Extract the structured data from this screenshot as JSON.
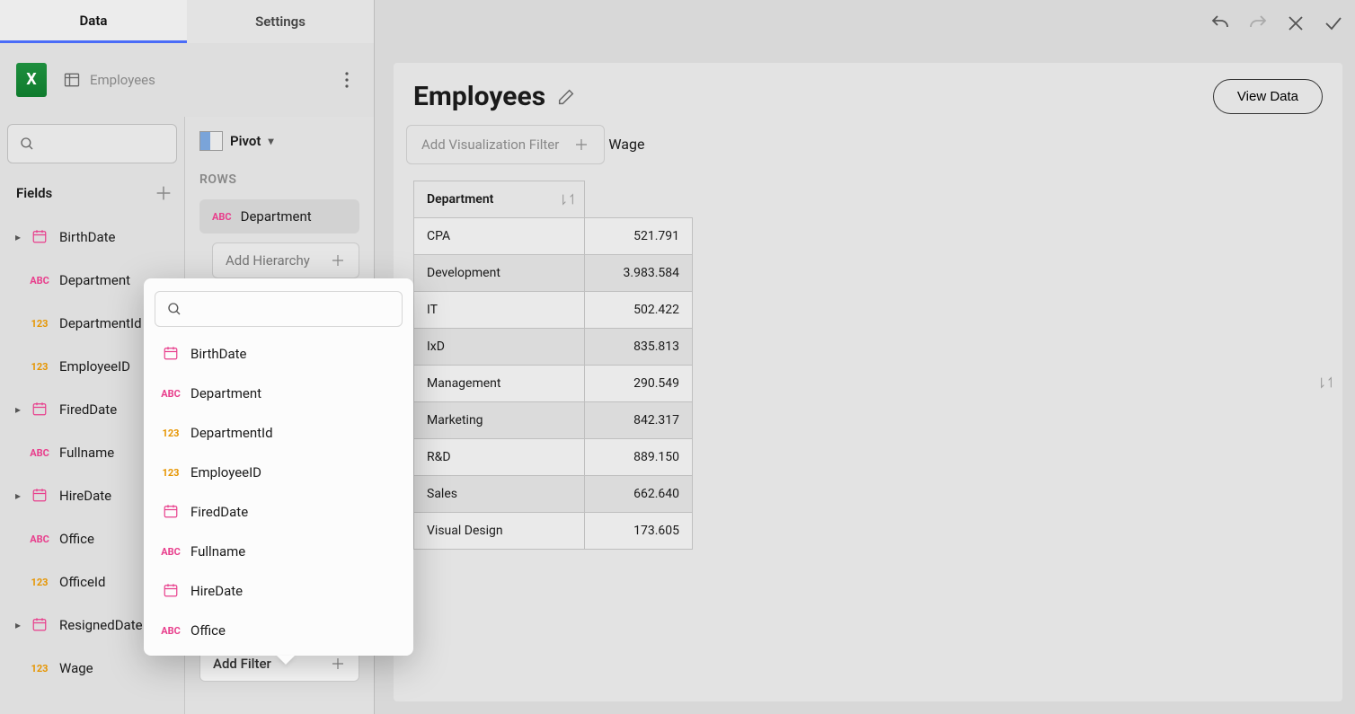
{
  "tabs": {
    "data": "Data",
    "settings": "Settings"
  },
  "datasource": {
    "name": "Employees"
  },
  "fields": {
    "header": "Fields",
    "items": [
      {
        "label": "BirthDate",
        "type": "date",
        "expandable": true
      },
      {
        "label": "Department",
        "type": "abc",
        "expandable": false
      },
      {
        "label": "DepartmentId",
        "type": "num",
        "expandable": false
      },
      {
        "label": "EmployeeID",
        "type": "num",
        "expandable": false
      },
      {
        "label": "FiredDate",
        "type": "date",
        "expandable": true
      },
      {
        "label": "Fullname",
        "type": "abc",
        "expandable": false
      },
      {
        "label": "HireDate",
        "type": "date",
        "expandable": true
      },
      {
        "label": "Office",
        "type": "abc",
        "expandable": false
      },
      {
        "label": "OfficeId",
        "type": "num",
        "expandable": false
      },
      {
        "label": "ResignedDate",
        "type": "date",
        "expandable": true
      },
      {
        "label": "Wage",
        "type": "num",
        "expandable": false
      }
    ]
  },
  "config": {
    "viz_type": "Pivot",
    "rows_label": "ROWS",
    "row_field": "Department",
    "add_hierarchy": "Add Hierarchy",
    "add_filter": "Add Filter"
  },
  "picker": {
    "items": [
      {
        "label": "BirthDate",
        "type": "date"
      },
      {
        "label": "Department",
        "type": "abc"
      },
      {
        "label": "DepartmentId",
        "type": "num"
      },
      {
        "label": "EmployeeID",
        "type": "num"
      },
      {
        "label": "FiredDate",
        "type": "date"
      },
      {
        "label": "Fullname",
        "type": "abc"
      },
      {
        "label": "HireDate",
        "type": "date"
      },
      {
        "label": "Office",
        "type": "abc"
      }
    ]
  },
  "viz": {
    "title": "Employees",
    "view_data": "View Data",
    "add_filter": "Add Visualization Filter",
    "columns": {
      "department": "Department",
      "wage": "Wage"
    },
    "rows": [
      {
        "dept": "CPA",
        "wage": "521.791"
      },
      {
        "dept": "Development",
        "wage": "3.983.584"
      },
      {
        "dept": "IT",
        "wage": "502.422"
      },
      {
        "dept": "IxD",
        "wage": "835.813"
      },
      {
        "dept": "Management",
        "wage": "290.549"
      },
      {
        "dept": "Marketing",
        "wage": "842.317"
      },
      {
        "dept": "R&D",
        "wage": "889.150"
      },
      {
        "dept": "Sales",
        "wage": "662.640"
      },
      {
        "dept": "Visual Design",
        "wage": "173.605"
      }
    ]
  },
  "chart_data": {
    "type": "table",
    "title": "Employees",
    "columns": [
      "Department",
      "Wage"
    ],
    "rows": [
      [
        "CPA",
        "521.791"
      ],
      [
        "Development",
        "3.983.584"
      ],
      [
        "IT",
        "502.422"
      ],
      [
        "IxD",
        "835.813"
      ],
      [
        "Management",
        "290.549"
      ],
      [
        "Marketing",
        "842.317"
      ],
      [
        "R&D",
        "889.150"
      ],
      [
        "Sales",
        "662.640"
      ],
      [
        "Visual Design",
        "173.605"
      ]
    ]
  }
}
